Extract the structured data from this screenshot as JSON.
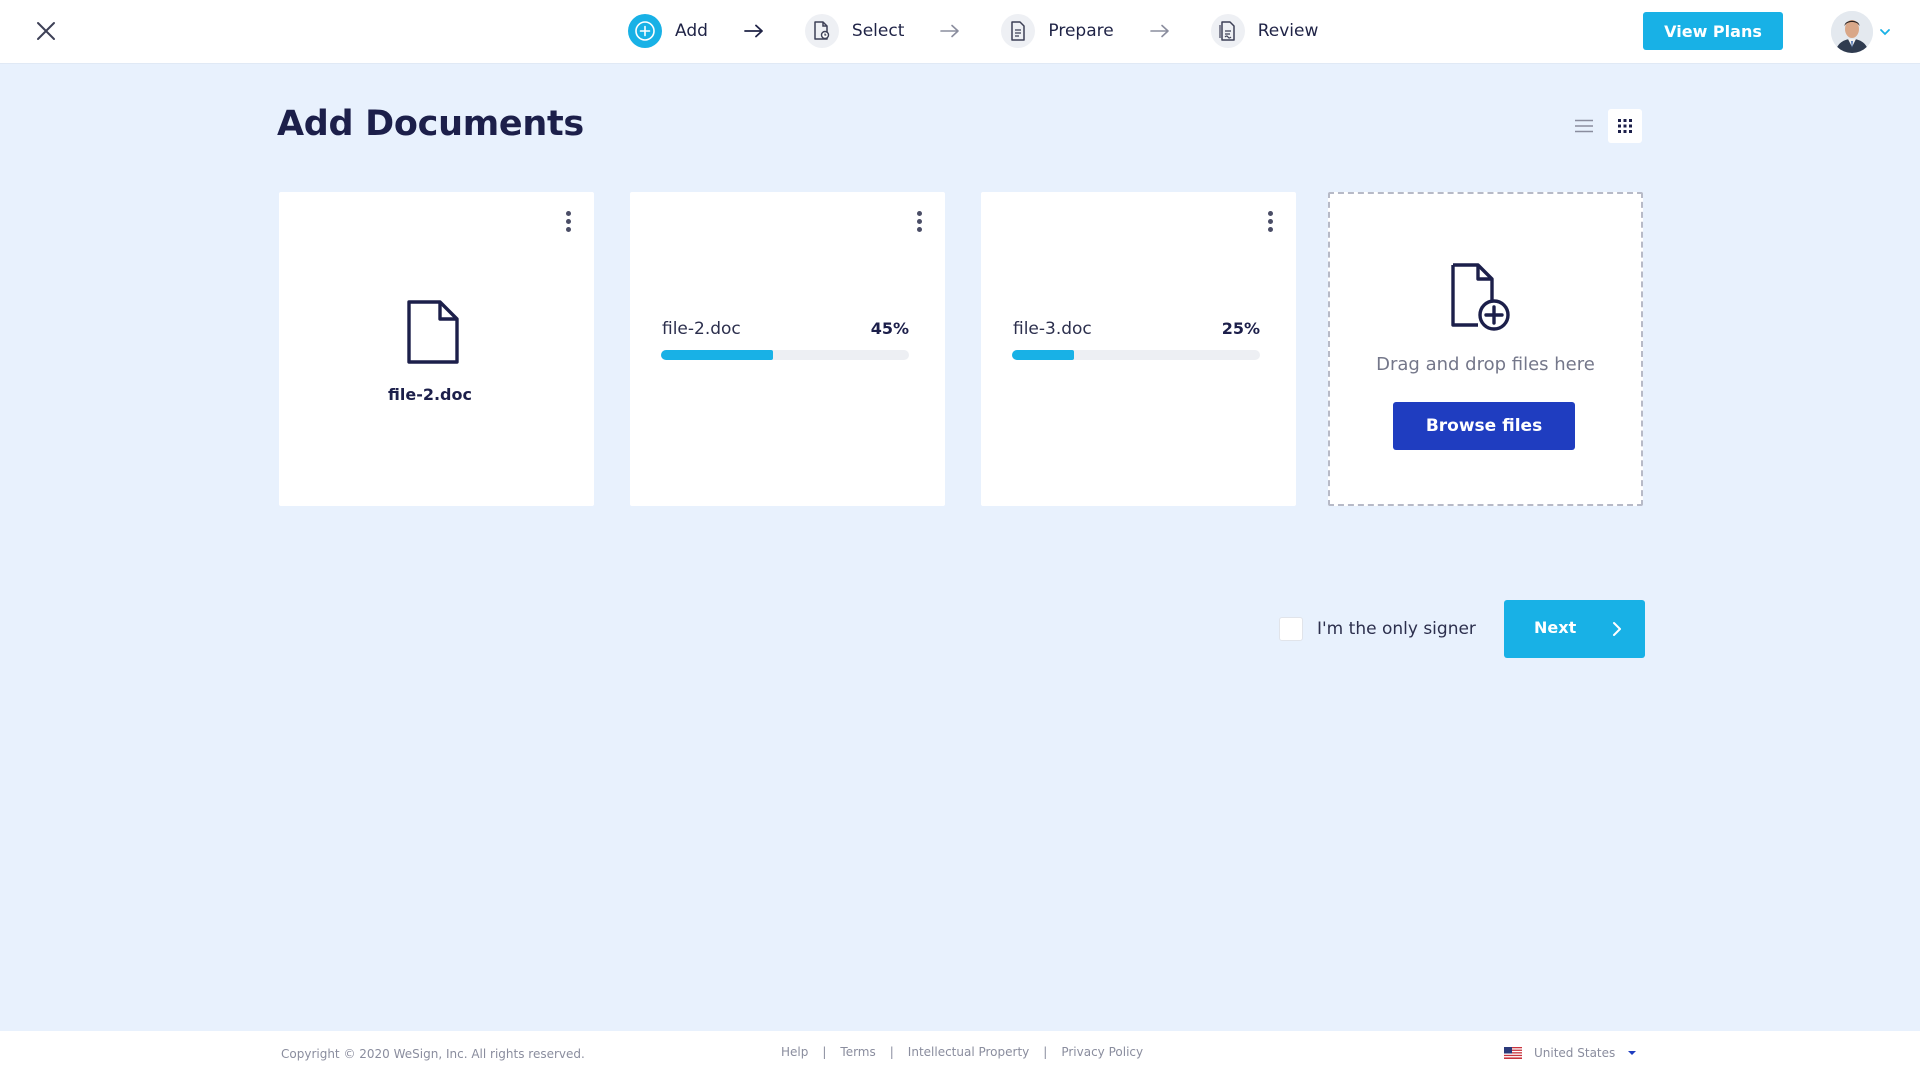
{
  "steps": [
    {
      "label": "Add",
      "icon": "plus-circle-icon"
    },
    {
      "label": "Select",
      "icon": "document-search-icon"
    },
    {
      "label": "Prepare",
      "icon": "document-lines-icon"
    },
    {
      "label": "Review",
      "icon": "document-signature-icon"
    }
  ],
  "header": {
    "view_plans_label": "View Plans"
  },
  "main": {
    "title": "Add Documents",
    "documents": [
      {
        "name": "file-2.doc",
        "status": "uploaded"
      },
      {
        "name": "file-2.doc",
        "status": "uploading",
        "progress_label": "45%",
        "progress": 0.45
      },
      {
        "name": "file-3.doc",
        "status": "uploading",
        "progress_label": "25%",
        "progress": 0.25
      }
    ],
    "dropzone": {
      "text": "Drag and drop files here",
      "browse_label": "Browse files"
    },
    "only_signer_label": "I'm the only signer",
    "next_label": "Next"
  },
  "footer": {
    "copyright": "Copyright © 2020 WeSign, Inc. All rights reserved.",
    "links": [
      "Help",
      "Terms",
      "Intellectual Property",
      "Privacy Policy"
    ],
    "separator": "|",
    "locale": "United States"
  },
  "colors": {
    "accent": "#18b1e6",
    "primary": "#1f3dc0",
    "heading": "#1c1f4a",
    "background": "#e8f1fd"
  }
}
